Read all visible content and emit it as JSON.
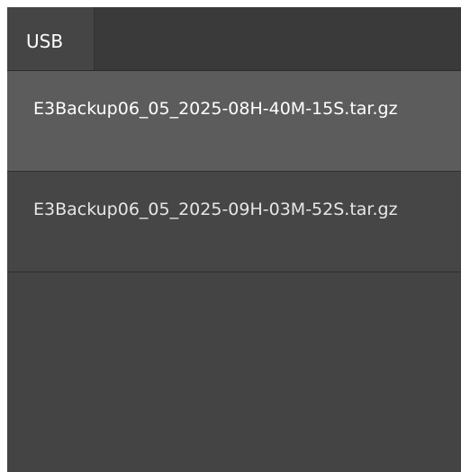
{
  "tabs": [
    {
      "label": "USB",
      "active": true
    }
  ],
  "files": [
    {
      "name": "E3Backup06_05_2025-08H-40M-15S.tar.gz",
      "selected": true
    },
    {
      "name": "E3Backup06_05_2025-09H-03M-52S.tar.gz",
      "selected": false
    }
  ],
  "colors": {
    "panel_bg": "#444444",
    "tabbar_bg": "#3a3a3a",
    "selected_row_bg": "#5c5c5c",
    "text": "#ffffff"
  }
}
